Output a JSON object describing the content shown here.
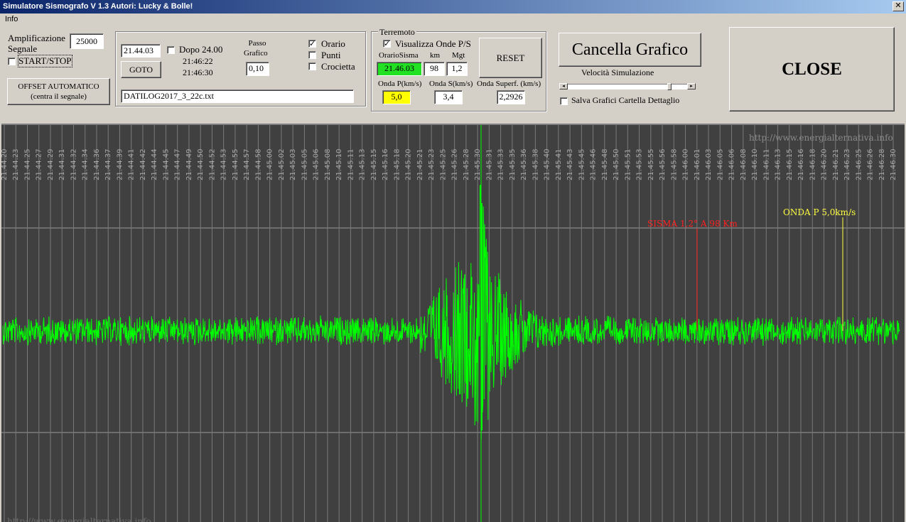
{
  "window": {
    "title": "Simulatore Sismografo V 1.3  Autori: Lucky & Bolle!",
    "close_glyph": "✕"
  },
  "menu": {
    "info": "Info"
  },
  "signal": {
    "amp_label_1": "Amplificazione",
    "amp_label_2": "Segnale",
    "amp_value": "25000",
    "start_stop_label": "START/STOP",
    "start_stop_checked": false,
    "offset_button_1": "OFFSET AUTOMATICO",
    "offset_button_2": "(centra il segnale)"
  },
  "time": {
    "time_value": "21.44.03",
    "goto_label": "GOTO",
    "after24_label": "Dopo 24.00",
    "after24_checked": false,
    "time_1": "21:46:22",
    "time_2": "21:46:30",
    "passo_label_1": "Passo",
    "passo_label_2": "Grafico",
    "passo_value": "0,10",
    "orario_label": "Orario",
    "orario_checked": true,
    "punti_label": "Punti",
    "punti_checked": false,
    "crocietta_label": "Crocietta",
    "crocietta_checked": false,
    "file_name": "DATILOG2017_3_22c.txt"
  },
  "quake": {
    "group_title": "Terremoto",
    "show_waves_label": "Visualizza Onde P/S",
    "show_waves_checked": true,
    "orario_sisma_label": "OrarioSisma",
    "km_label": "km",
    "mgt_label": "Mgt",
    "orario_sisma_value": "21.46.03",
    "km_value": "98",
    "mgt_value": "1,2",
    "reset_label": "RESET",
    "onda_p_label": "Onda P(km/s)",
    "onda_s_label": "Onda S(km/s)",
    "onda_sup_label": "Onda Superf. (km/s)",
    "onda_p_value": "5,0",
    "onda_s_value": "3,4",
    "onda_sup_value": "2,2926",
    "time_color": "#22e022",
    "p_color": "#ffff00"
  },
  "controls": {
    "cancella_label": "Cancella Grafico",
    "velocita_label": "Velocità Simulazione",
    "slider_value": 0.87,
    "salva_label": "Salva Grafici Cartella Dettaglio",
    "salva_checked": false,
    "close_label": "CLOSE"
  },
  "graph": {
    "background": "#404040",
    "signal_color": "#00ff00",
    "watermark": "http://www.energialternativa.info",
    "watermark_bottom": "http://www.energialternativa.info",
    "time_labels": [
      "21.44.20",
      "21.44.23",
      "21.44.25",
      "21.44.27",
      "21.44.29",
      "21.44.31",
      "21.44.32",
      "21.44.34",
      "21.44.36",
      "21.44.37",
      "21.44.39",
      "21.44.41",
      "21.44.42",
      "21.44.44",
      "21.44.45",
      "21.44.47",
      "21.44.49",
      "21.44.50",
      "21.44.52",
      "21.44.53",
      "21.44.55",
      "21.44.57",
      "21.44.58",
      "21.45.00",
      "21.45.02",
      "21.45.03",
      "21.45.05",
      "21.45.06",
      "21.45.08",
      "21.45.10",
      "21.45.11",
      "21.45.13",
      "21.45.15",
      "21.45.16",
      "21.45.18",
      "21.45.20",
      "21.45.21",
      "21.45.23",
      "21.45.25",
      "21.45.26",
      "21.45.28",
      "21.45.30",
      "21.45.31",
      "21.45.33",
      "21.45.35",
      "21.45.36",
      "21.45.38",
      "21.45.40",
      "21.45.41",
      "21.45.43",
      "21.45.45",
      "21.45.46",
      "21.45.48",
      "21.45.50",
      "21.45.51",
      "21.45.53",
      "21.45.55",
      "21.45.56",
      "21.45.58",
      "21.46.00",
      "21.46.01",
      "21.46.03",
      "21.46.05",
      "21.46.06",
      "21.46.08",
      "21.46.10",
      "21.46.11",
      "21.46.13",
      "21.46.15",
      "21.46.16",
      "21.46.18",
      "21.46.20",
      "21.46.21",
      "21.46.23",
      "21.46.25",
      "21.46.26",
      "21.46.28",
      "21.46.30"
    ],
    "sisma_marker": {
      "label": "SISMA 1,2° A 98 Km",
      "color": "#ff2020"
    },
    "onda_p_marker": {
      "label": "ONDA P 5,0km/s",
      "color": "#ffff40"
    }
  }
}
